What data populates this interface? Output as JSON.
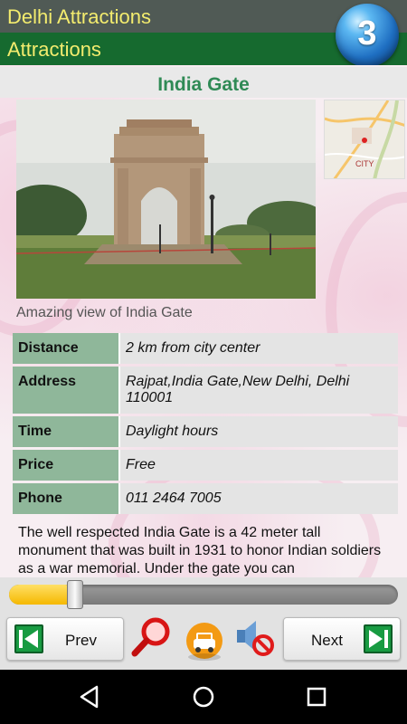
{
  "app": {
    "title": "Delhi Attractions",
    "section": "Attractions",
    "badge": "3"
  },
  "place": {
    "name": "India Gate",
    "caption": "Amazing view of India Gate",
    "map_label": "CITY"
  },
  "info": [
    {
      "key": "Distance",
      "value": "2 km from city center"
    },
    {
      "key": "Address",
      "value": "Rajpat,India Gate,New Delhi, Delhi 110001"
    },
    {
      "key": "Time",
      "value": "Daylight hours"
    },
    {
      "key": "Price",
      "value": "Free"
    },
    {
      "key": "Phone",
      "value": "011 2464 7005"
    }
  ],
  "description": "The well respected India Gate is a 42 meter tall monument that was built in 1931 to honor Indian soldiers as a war memorial. Under the gate you can",
  "player": {
    "progress": 0.17
  },
  "controls": {
    "prev_label": "Prev",
    "next_label": "Next"
  },
  "icons": {
    "search": "magnifier-icon",
    "directions": "car-icon",
    "mute": "speaker-muted-icon",
    "back": "back-triangle-icon",
    "home": "home-circle-icon",
    "recents": "recents-square-icon"
  },
  "colors": {
    "app_bar": "#505a55",
    "sub_bar": "#166a2f",
    "title_text": "#f3ec6e",
    "place_title": "#2f8a55"
  }
}
